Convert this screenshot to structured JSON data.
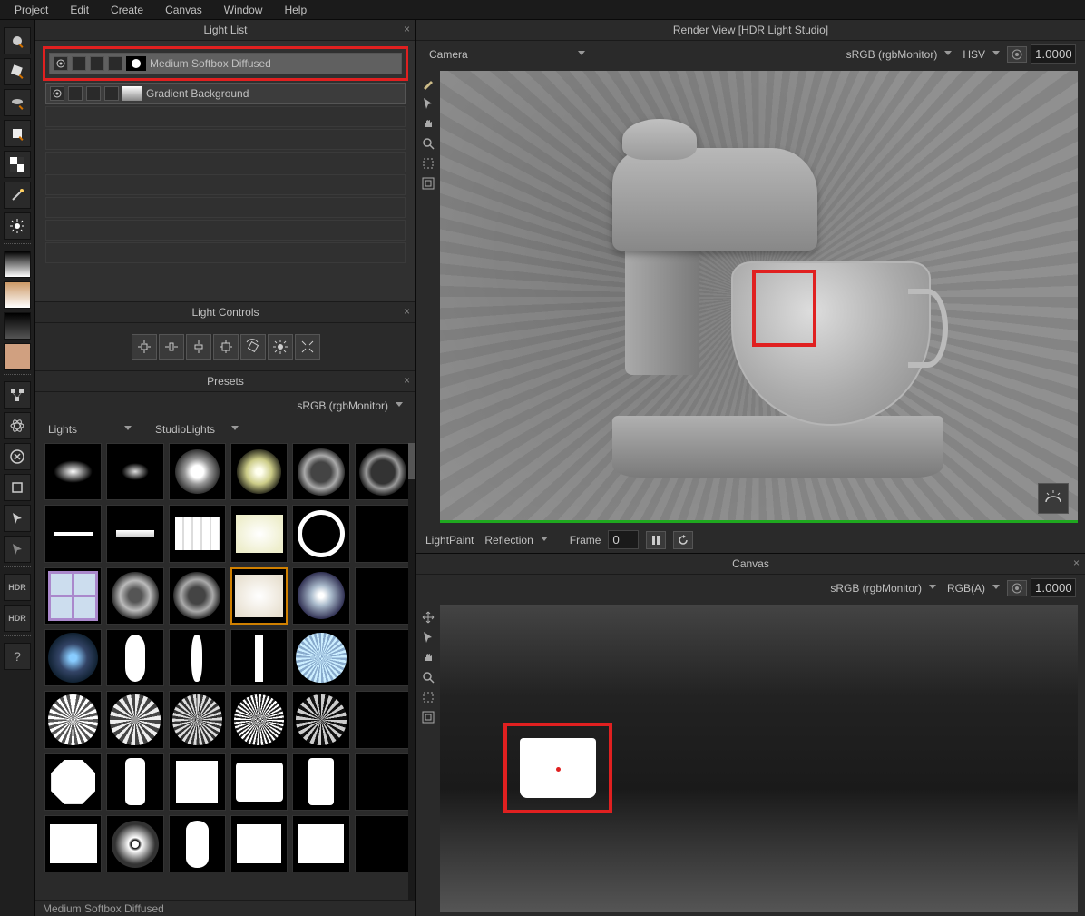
{
  "menu": [
    "Project",
    "Edit",
    "Create",
    "Canvas",
    "Window",
    "Help"
  ],
  "panels": {
    "light_list": {
      "title": "Light List",
      "items": [
        {
          "name": "Medium Softbox Diffused",
          "selected": true
        },
        {
          "name": "Gradient Background",
          "selected": false
        }
      ]
    },
    "light_controls": {
      "title": "Light Controls"
    },
    "presets": {
      "title": "Presets",
      "colorspace": "sRGB (rgbMonitor)",
      "category": "Lights",
      "subcategory": "StudioLights",
      "status": "Medium Softbox Diffused"
    },
    "render": {
      "title": "Render View [HDR Light Studio]",
      "camera": "Camera",
      "colorspace": "sRGB (rgbMonitor)",
      "colormode": "HSV",
      "exposure": "1.0000",
      "lightpaint_label": "LightPaint",
      "lightpaint_mode": "Reflection",
      "frame_label": "Frame",
      "frame_value": "0"
    },
    "canvas": {
      "title": "Canvas",
      "colorspace": "sRGB (rgbMonitor)",
      "colormode": "RGB(A)",
      "exposure": "1.0000"
    }
  }
}
